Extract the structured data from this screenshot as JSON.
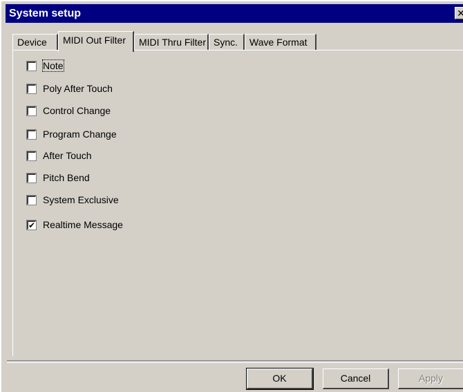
{
  "window": {
    "title": "System setup",
    "close_glyph": "✕"
  },
  "tabs": [
    {
      "label": "Device"
    },
    {
      "label": "MIDI Out Filter"
    },
    {
      "label": "MIDI Thru Filter"
    },
    {
      "label": "Sync."
    },
    {
      "label": "Wave Format"
    }
  ],
  "active_tab": "MIDI Out Filter",
  "filters": [
    {
      "label": "Note",
      "checked": false,
      "check": ""
    },
    {
      "label": "Poly After Touch",
      "checked": false,
      "check": ""
    },
    {
      "label": "Control Change",
      "checked": false,
      "check": ""
    },
    {
      "label": "Program Change",
      "checked": false,
      "check": ""
    },
    {
      "label": "After Touch",
      "checked": false,
      "check": ""
    },
    {
      "label": "Pitch Bend",
      "checked": false,
      "check": ""
    },
    {
      "label": "System Exclusive",
      "checked": false,
      "check": ""
    },
    {
      "label": "Realtime Message",
      "checked": true,
      "check": "✔"
    }
  ],
  "buttons": {
    "ok": "OK",
    "cancel": "Cancel",
    "apply": "Apply"
  },
  "colors": {
    "titlebar": "#000080",
    "face": "#d4d0c8"
  }
}
